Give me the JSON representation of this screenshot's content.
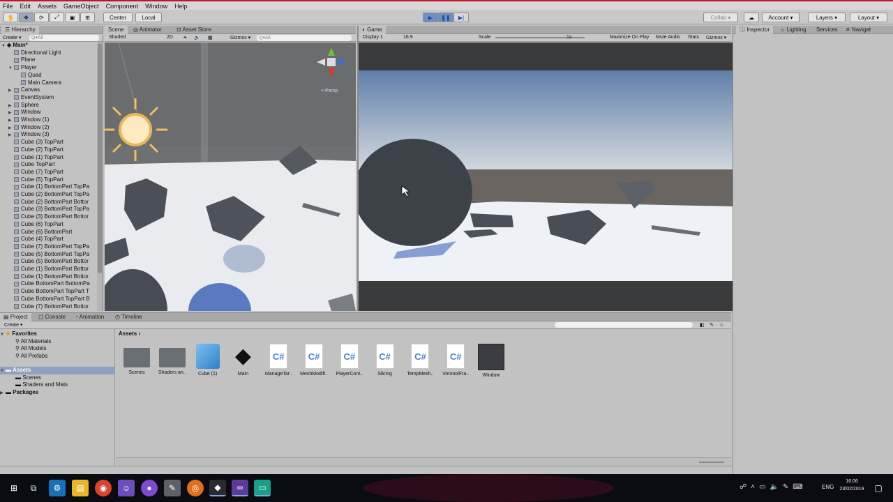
{
  "menu": [
    "File",
    "Edit",
    "Assets",
    "GameObject",
    "Component",
    "Window",
    "Help"
  ],
  "toolbar": {
    "center": "Center",
    "local": "Local",
    "collab": "Collab ▾",
    "account": "Account",
    "layers": "Layers",
    "layout": "Layout"
  },
  "hierarchy": {
    "tab": "Hierarchy",
    "create": "Create ▾",
    "search": "Q▾All",
    "scene": "Main*",
    "items": [
      "Directional Light",
      "Plane",
      "Player",
      "Quad",
      "Main Camera",
      "Canvas",
      "EventSystem",
      "Sphere",
      "Window",
      "Window (1)",
      "Window (2)",
      "Window (3)",
      "Cube (3) TopPart",
      "Cube (2) TopPart",
      "Cube (1) TopPart",
      "Cube TopPart",
      "Cube (7) TopPart",
      "Cube (5) TopPart",
      "Cube (1) BottomPart TopPa",
      "Cube (2) BottomPart TopPa",
      "Cube (2) BottomPart Bottor",
      "Cube (3) BottomPart TopPa",
      "Cube (3) BottomPart Bottor",
      "Cube (6) TopPart",
      "Cube (6) BottomPart",
      "Cube (4) TopPart",
      "Cube (7) BottomPart TopPa",
      "Cube (5) BottomPart TopPa",
      "Cube (5) BottomPart Bottor",
      "Cube (1) BottomPart Bottor",
      "Cube (1) BottomPart Bottor",
      "Cube BottomPart BottomPa",
      "Cube BottomPart TopPart T",
      "Cube BottomPart TopPart B",
      "Cube (7) BottomPart Bottor"
    ]
  },
  "scene": {
    "tabs": [
      "Scene",
      "Animator",
      "Asset Store"
    ],
    "shaded": "Shaded",
    "mode2d": "2D",
    "gizmos": "Gizmos ▾",
    "search": "Q▾All",
    "persp": "< Persp"
  },
  "game": {
    "tab": "Game",
    "display": "Display 1",
    "aspect": "16:9",
    "scale_label": "Scale",
    "scale_value": "1x",
    "max": "Maximize On Play",
    "mute": "Mute Audio",
    "stats": "Stats",
    "gizmos": "Gizmos ▾"
  },
  "inspector": {
    "tabs": [
      "Inspector",
      "Lighting",
      "Services",
      "Navigat"
    ]
  },
  "bottom": {
    "tabs": [
      "Project",
      "Console",
      "Animation",
      "Timeline"
    ],
    "create": "Create ▾",
    "breadcrumb": "Assets",
    "favorites": {
      "label": "Favorites",
      "items": [
        "All Materials",
        "All Models",
        "All Prefabs"
      ]
    },
    "assets": {
      "label": "Assets",
      "items": [
        "Scenes",
        "Shaders and Mats"
      ]
    },
    "packages": "Packages",
    "files": [
      {
        "name": "Scenes",
        "kind": "folder"
      },
      {
        "name": "Shaders an..",
        "kind": "folder"
      },
      {
        "name": "Cube (1)",
        "kind": "cube"
      },
      {
        "name": "Main",
        "kind": "unity"
      },
      {
        "name": "ManageTar..",
        "kind": "cs"
      },
      {
        "name": "MeshModifi..",
        "kind": "cs"
      },
      {
        "name": "PlayerCont..",
        "kind": "cs"
      },
      {
        "name": "Slicing",
        "kind": "cs"
      },
      {
        "name": "TempMesh..",
        "kind": "cs"
      },
      {
        "name": "VoronoiFra..",
        "kind": "cs"
      },
      {
        "name": "Window",
        "kind": "dark"
      }
    ]
  },
  "taskbar": {
    "lang": "ENG",
    "time": "16:06",
    "date": "23/02/2019"
  }
}
